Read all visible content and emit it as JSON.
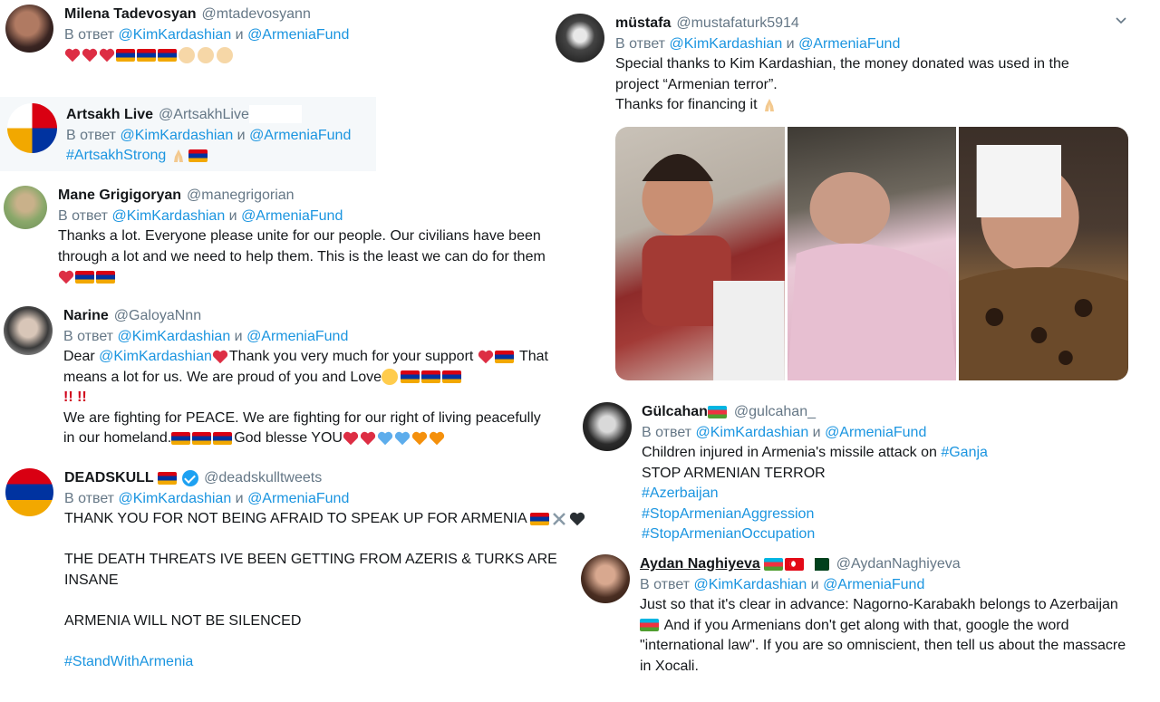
{
  "colors": {
    "link": "#1b95e0",
    "muted": "#657786",
    "text": "#14171a"
  },
  "reply_prefix": "В ответ",
  "reply_and": "и",
  "tweets": [
    {
      "name": "Milena Tadevosyan",
      "handle": "@mtadevosyann",
      "reply_to": [
        "@KimKardashian",
        "@ArmeniaFund"
      ],
      "emoji": [
        "red-heart",
        "red-heart",
        "red-heart",
        "armenia-flag",
        "armenia-flag",
        "armenia-flag",
        "raised-fist",
        "raised-fist",
        "raised-fist"
      ]
    },
    {
      "name": "Artsakh Live",
      "handle": "@ArtsakhLive",
      "reply_to": [
        "@KimKardashian",
        "@ArmeniaFund"
      ],
      "hashtag": "#ArtsakhStrong"
    },
    {
      "name": "Mane Grigigoryan",
      "handle": "@manegrigorian",
      "reply_to": [
        "@KimKardashian",
        "@ArmeniaFund"
      ],
      "lines": [
        "Thanks a lot. Everyone please unite for our people. Our civilians have been",
        "through a lot and we need to help them. This is the least we can do for them"
      ]
    },
    {
      "name": "Narine",
      "handle": "@GaloyaNnn",
      "reply_to": [
        "@KimKardashian",
        "@ArmeniaFund"
      ],
      "dear": "Dear",
      "mention": "@KimKardashian",
      "l1b": "Thank you very much for your support",
      "l1c": "That",
      "l2": "means a lot for us. We are proud of you and Love",
      "bangs": "!! !!",
      "l4": "We are fighting for PEACE. We are fighting for our right of living peacefully",
      "l5a": "in our homeland.",
      "l5b": "God blesse YOU"
    },
    {
      "name": "DEADSKULL",
      "handle": "@deadskulltweets",
      "reply_to": [
        "@KimKardashian",
        "@ArmeniaFund"
      ],
      "l1": "THANK YOU FOR NOT BEING AFRAID TO SPEAK UP FOR ARMENIA",
      "l2": "THE DEATH THREATS IVE BEEN GETTING FROM AZERIS & TURKS ARE",
      "l3": "INSANE",
      "l4": "ARMENIA WILL NOT BE SILENCED",
      "hashtag": "#StandWithArmenia"
    },
    {
      "name": "müstafa",
      "handle": "@mustafaturk5914",
      "reply_to": [
        "@KimKardashian",
        "@ArmeniaFund"
      ],
      "l1": "Special thanks to Kim Kardashian, the money donated was used in the",
      "l2": "project “Armenian terror”.",
      "l3": "Thanks for financing it"
    },
    {
      "name": "Gülcahan",
      "handle": "@gulcahan_",
      "reply_to": [
        "@KimKardashian",
        "@ArmeniaFund"
      ],
      "l1a": "Children injured in Armenia's missile attack on",
      "l1b": "#Ganja",
      "l2": "STOP ARMENIAN TERROR",
      "tags": [
        "#Azerbaijan",
        "#StopArmenianAggression",
        "#StopArmenianOccupation"
      ]
    },
    {
      "name": "Aydan Naghiyeva",
      "handle": "@AydanNaghiyeva",
      "reply_to": [
        "@KimKardashian",
        "@ArmeniaFund"
      ],
      "l1": "Just so that it's clear in advance: Nagorno-Karabakh belongs to Azerbaijan",
      "l2": "And if you Armenians don't get along with that, google the word",
      "l3": "\"international law\". If you are so omniscient, then tell us about the massacre",
      "l4": "in Xocali."
    }
  ]
}
